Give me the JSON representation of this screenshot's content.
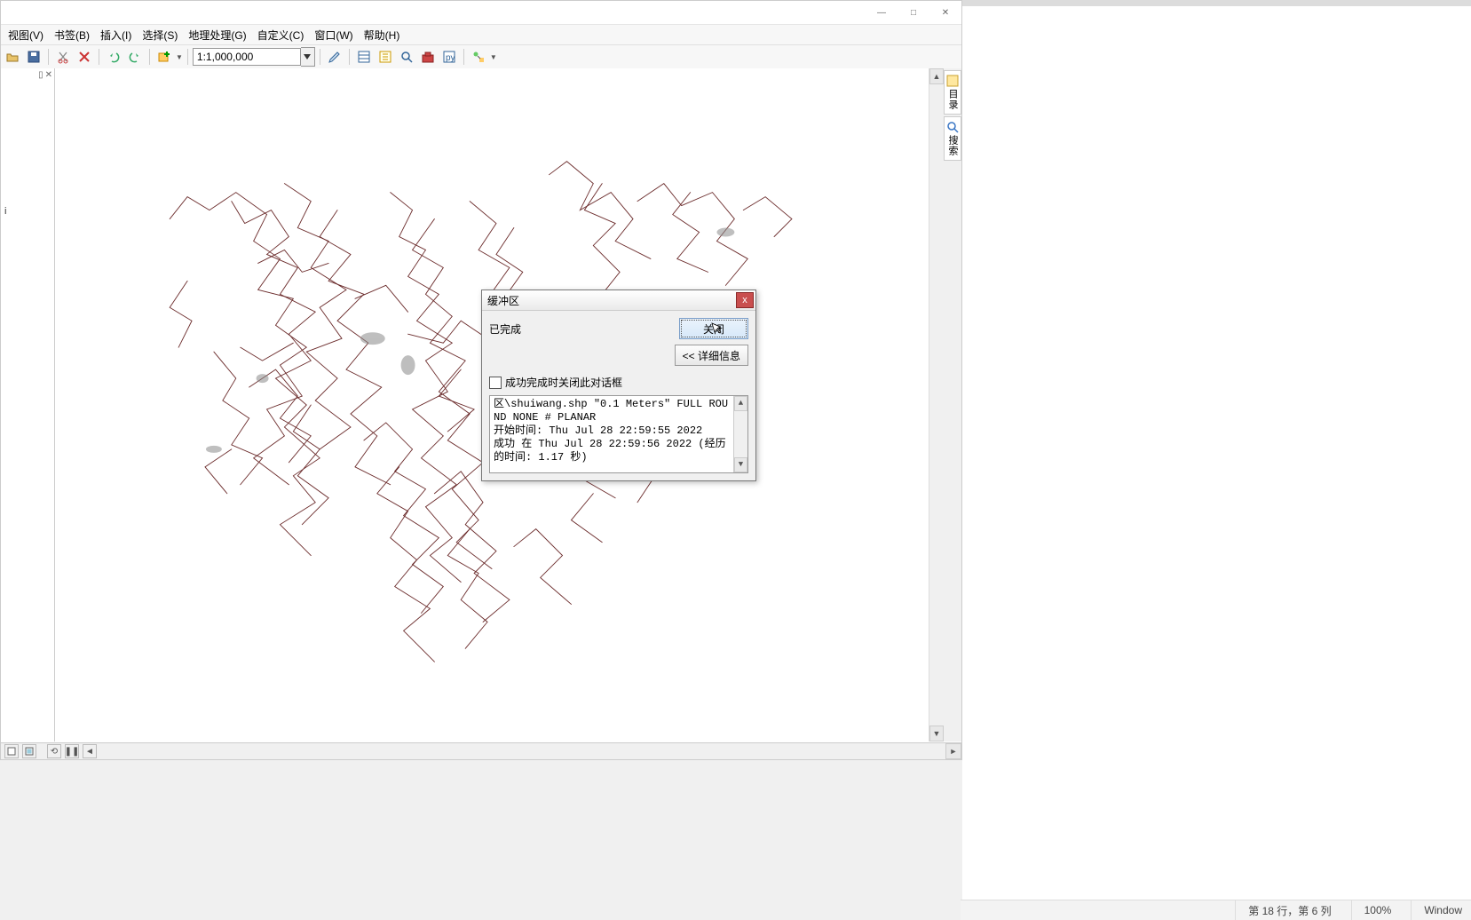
{
  "window": {
    "minimize": "—",
    "maximize": "□",
    "close": "✕"
  },
  "menu": {
    "view": "视图(V)",
    "bookmarks": "书签(B)",
    "insert": "插入(I)",
    "selection": "选择(S)",
    "geoprocessing": "地理处理(G)",
    "customize": "自定义(C)",
    "window": "窗口(W)",
    "help": "帮助(H)"
  },
  "toolbar1": {
    "scale_value": "1:1,000,000"
  },
  "panel": {
    "pin": "▯",
    "close": "✕",
    "item": "i"
  },
  "side_tabs": {
    "catalog": "目录",
    "search": "搜索"
  },
  "dialog": {
    "title": "缓冲区",
    "status": "已完成",
    "close_btn": "关闭",
    "close_x": "x",
    "details_btn": "<< 详细信息",
    "checkbox_label": "成功完成时关闭此对话框",
    "log_text": "区\\shuiwang.shp \"0.1 Meters\" FULL ROUND NONE # PLANAR\n开始时间: Thu Jul 28 22:59:55 2022\n成功 在 Thu Jul 28 22:59:56 2022 (经历的时间: 1.17 秒)"
  },
  "bottom": {
    "refresh": "⟲",
    "pause": "❚❚",
    "hscroll_left": "◄",
    "hscroll_right": "►"
  },
  "host_status": {
    "position": "第 18 行，第 6 列",
    "zoom": "100%",
    "os": "Window"
  },
  "scroll": {
    "up": "▲",
    "down": "▼"
  }
}
